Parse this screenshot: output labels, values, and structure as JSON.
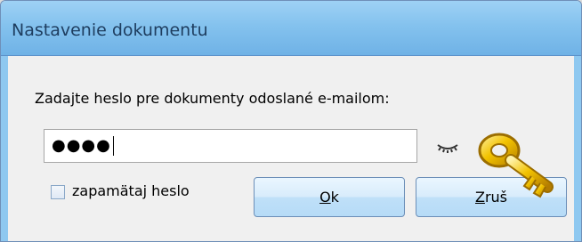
{
  "window": {
    "title": "Nastavenie dokumentu"
  },
  "dialog": {
    "prompt": "Zadajte heslo pre dokumenty odoslané e-mailom:",
    "password": {
      "masked_value": "●●●●",
      "toggle_icon": "eye-closed-icon"
    },
    "remember": {
      "label": "zapamätaj heslo",
      "checked": false
    },
    "buttons": {
      "ok": {
        "accel": "O",
        "rest": "k"
      },
      "cancel": {
        "accel": "Z",
        "rest": "ruš"
      }
    },
    "decor": {
      "icon": "key-icon",
      "accent": "#f2c200"
    }
  }
}
